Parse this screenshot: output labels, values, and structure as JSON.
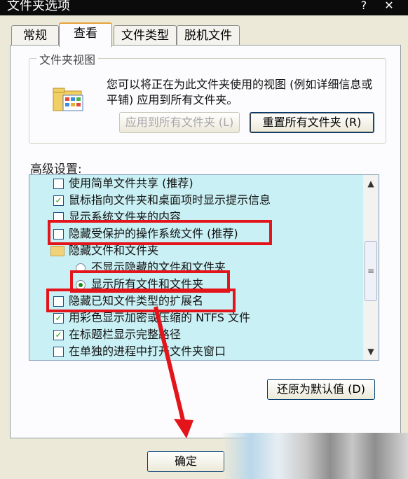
{
  "window": {
    "title": "文件夹选项",
    "help_glyph": "?",
    "close_glyph": "✕"
  },
  "tabs": [
    {
      "label": "常规",
      "active": false
    },
    {
      "label": "查看",
      "active": true
    },
    {
      "label": "文件类型",
      "active": false
    },
    {
      "label": "脱机文件",
      "active": false
    }
  ],
  "folder_views": {
    "group_label": "文件夹视图",
    "icon": "folder-view-icon",
    "description": "您可以将正在为此文件夹使用的视图 (例如详细信息或平铺) 应用到所有文件夹。",
    "apply_all_label": "应用到所有文件夹 (L)",
    "reset_all_label": "重置所有文件夹 (R)"
  },
  "advanced": {
    "label": "高级设置:",
    "items": [
      {
        "type": "checkbox",
        "checked": false,
        "label": "使用简单文件共享 (推荐)"
      },
      {
        "type": "checkbox",
        "checked": true,
        "label": "鼠标指向文件夹和桌面项时显示提示信息"
      },
      {
        "type": "checkbox",
        "checked": false,
        "label": "显示系统文件夹的内容"
      },
      {
        "type": "checkbox",
        "checked": false,
        "label": "隐藏受保护的操作系统文件 (推荐)"
      },
      {
        "type": "folder",
        "label": "隐藏文件和文件夹"
      },
      {
        "type": "radio",
        "checked": false,
        "label": "不显示隐藏的文件和文件夹"
      },
      {
        "type": "radio",
        "checked": true,
        "label": "显示所有文件和文件夹"
      },
      {
        "type": "checkbox",
        "checked": false,
        "label": "隐藏已知文件类型的扩展名"
      },
      {
        "type": "checkbox",
        "checked": true,
        "label": "用彩色显示加密或压缩的 NTFS 文件"
      },
      {
        "type": "checkbox",
        "checked": true,
        "label": "在标题栏显示完整路径"
      },
      {
        "type": "checkbox",
        "checked": false,
        "label": "在单独的进程中打开文件夹窗口"
      }
    ],
    "restore_defaults_label": "还原为默认值 (D)"
  },
  "footer": {
    "ok_label": "确定"
  },
  "colors": {
    "highlight_box": "#e4141b",
    "list_background": "#c9f0f4",
    "checkmark": "#21a121"
  }
}
